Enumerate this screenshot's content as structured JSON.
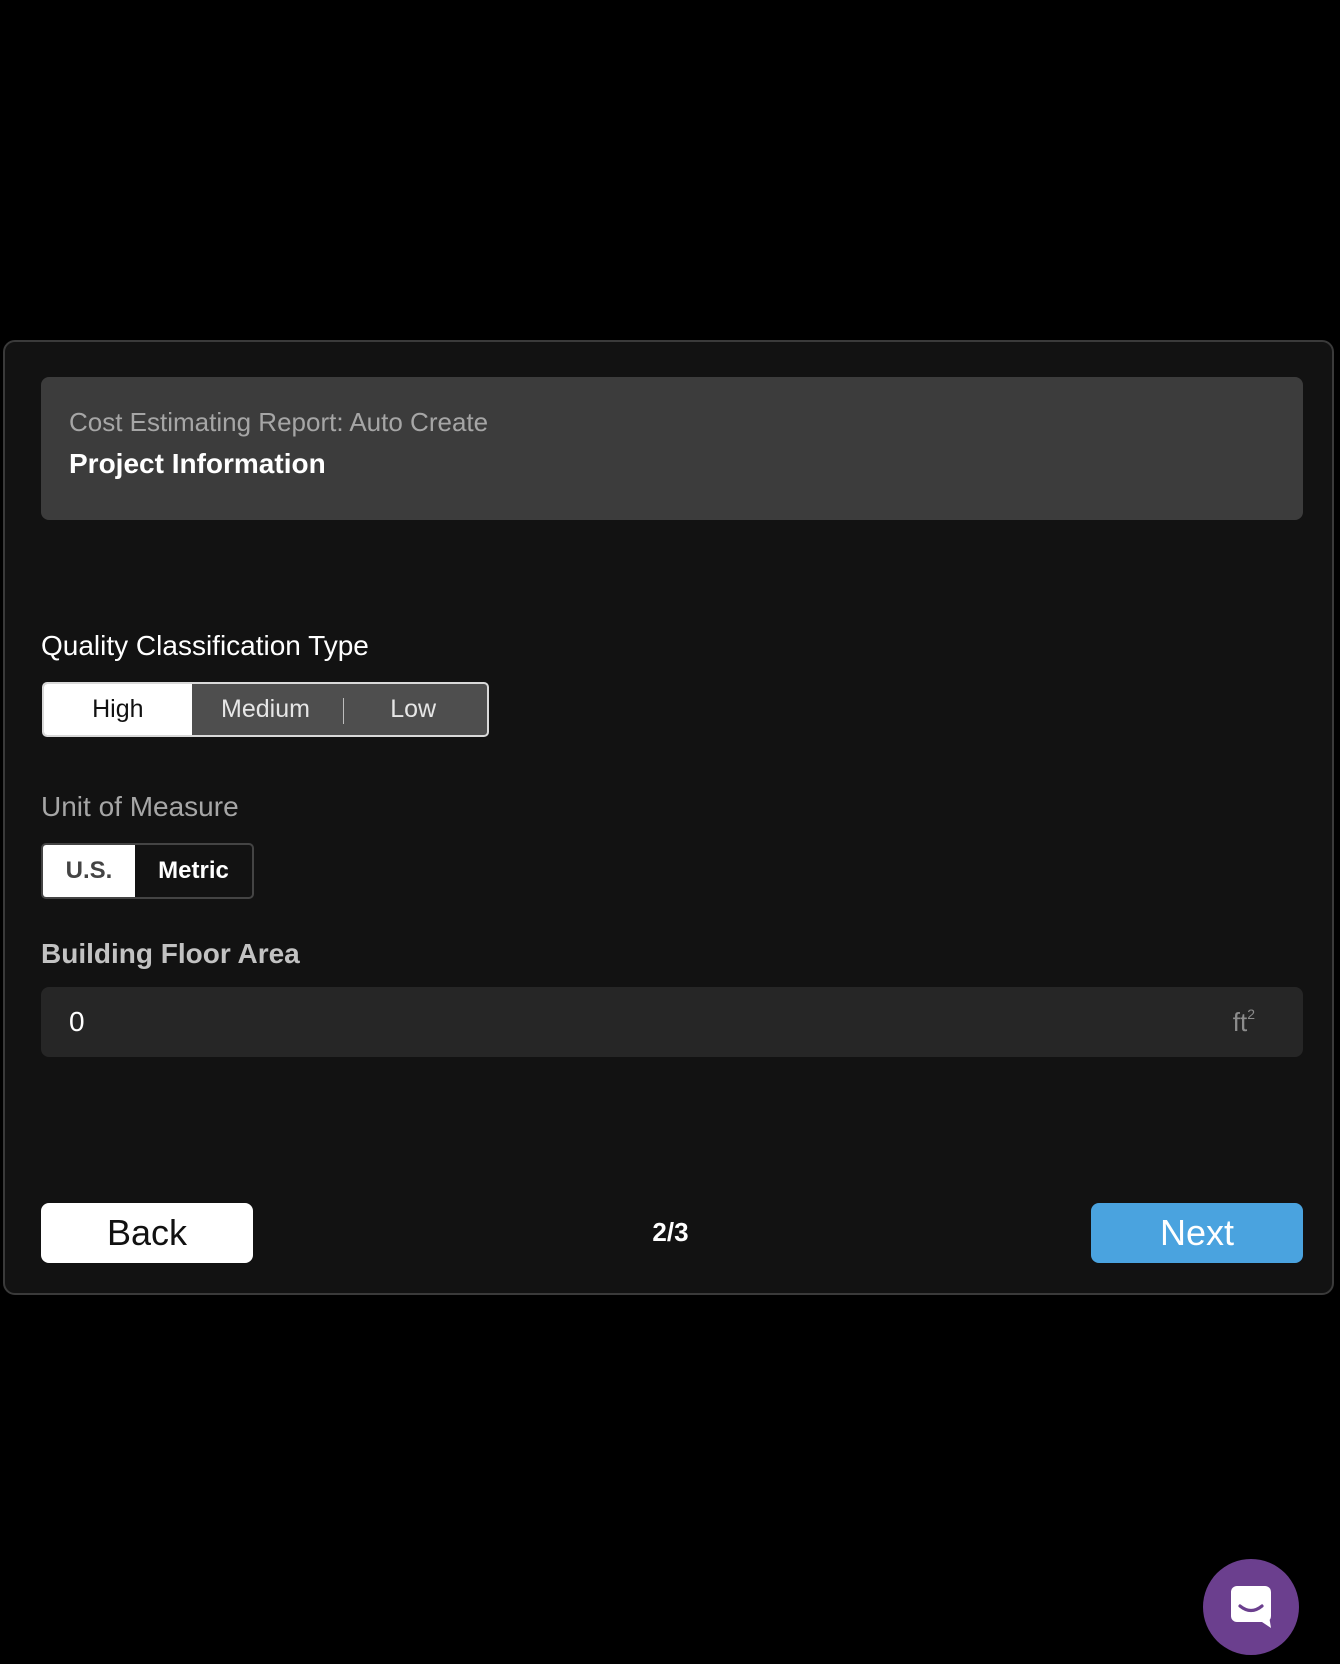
{
  "header": {
    "subtitle": "Cost Estimating Report: Auto Create",
    "title": "Project Information"
  },
  "quality": {
    "label": "Quality Classification Type",
    "options": [
      "High",
      "Medium",
      "Low"
    ],
    "selected": "High"
  },
  "unit": {
    "label": "Unit of Measure",
    "options": [
      "U.S.",
      "Metric"
    ],
    "selected": "U.S."
  },
  "area": {
    "label": "Building Floor Area",
    "value": "0",
    "unit": "ft",
    "unit_exponent": "2"
  },
  "footer": {
    "back_label": "Back",
    "page_indicator": "2/3",
    "next_label": "Next"
  },
  "colors": {
    "accent": "#4aa3df",
    "chat": "#6b3f8e"
  },
  "icons": {
    "chat_launcher": "chat-bubble-icon"
  }
}
